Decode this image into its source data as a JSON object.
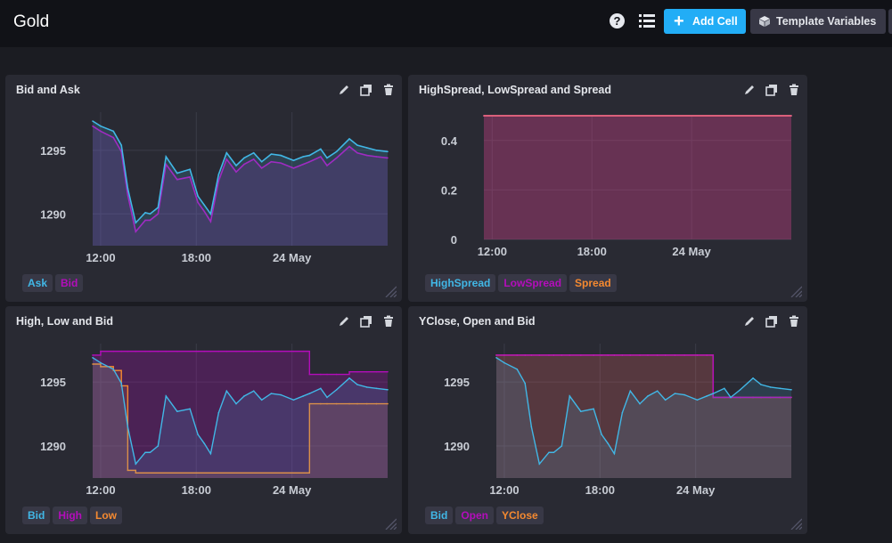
{
  "header": {
    "title": "Gold",
    "add_cell_label": "Add Cell",
    "template_variables_label": "Template Variables",
    "help_glyph": "?"
  },
  "colors": {
    "background": "#1b1c22",
    "cell": "#292a33",
    "accent": "#22adf6",
    "ask": "#41b7e6",
    "bid_purple": "#b40dbb",
    "bid_blue": "#4cc0f0",
    "orange": "#f48930",
    "salmon": "#f66c6f"
  },
  "icons": [
    "help-icon",
    "list-icon",
    "plus-icon",
    "cube-icon",
    "pencil-icon",
    "duplicate-icon",
    "trash-icon",
    "resize-handle-icon"
  ],
  "cells": [
    {
      "title": "Bid and Ask",
      "legend": [
        {
          "label": "Ask",
          "color": "#41b7e6"
        },
        {
          "label": "Bid",
          "color": "#b40dbb"
        }
      ]
    },
    {
      "title": "HighSpread, LowSpread and Spread",
      "legend": [
        {
          "label": "HighSpread",
          "color": "#41b7e6"
        },
        {
          "label": "LowSpread",
          "color": "#b40dbb"
        },
        {
          "label": "Spread",
          "color": "#f48930"
        }
      ]
    },
    {
      "title": "High, Low and Bid",
      "legend": [
        {
          "label": "Bid",
          "color": "#41b7e6"
        },
        {
          "label": "High",
          "color": "#b40dbb"
        },
        {
          "label": "Low",
          "color": "#f48930"
        }
      ]
    },
    {
      "title": "YClose, Open and Bid",
      "legend": [
        {
          "label": "Bid",
          "color": "#41b7e6"
        },
        {
          "label": "Open",
          "color": "#b40dbb"
        },
        {
          "label": "YClose",
          "color": "#f48930"
        }
      ]
    }
  ],
  "chart_data": [
    {
      "type": "line",
      "title": "Bid and Ask",
      "x_ticks": [
        "12:00",
        "18:00",
        "24 May"
      ],
      "y_ticks": [
        1295,
        1290
      ],
      "ylim": [
        1287.5,
        1298
      ],
      "grid": true,
      "x": [
        0,
        0.5,
        1.3,
        1.8,
        2.2,
        2.7,
        3.3,
        3.6,
        4.1,
        4.6,
        5.3,
        6.1,
        6.6,
        7.0,
        7.4,
        7.9,
        8.4,
        9.0,
        9.5,
        10.1,
        10.6,
        11.2,
        11.8,
        12.6,
        13.2,
        13.6,
        14.3,
        14.7,
        15.3,
        16.1,
        16.6,
        17.2,
        17.8,
        18.5
      ],
      "series": [
        {
          "name": "Ask",
          "values": [
            1297.3,
            1296.9,
            1296.5,
            1295.4,
            1292.0,
            1289.3,
            1290.1,
            1290.0,
            1290.5,
            1294.5,
            1293.2,
            1293.5,
            1291.4,
            1290.7,
            1290.0,
            1293.1,
            1294.8,
            1293.8,
            1294.4,
            1294.8,
            1294.1,
            1294.7,
            1294.6,
            1294.2,
            1294.5,
            1294.6,
            1295.1,
            1294.4,
            1294.9,
            1295.9,
            1295.4,
            1295.2,
            1295.0,
            1294.9
          ]
        },
        {
          "name": "Bid",
          "values": [
            1296.9,
            1296.5,
            1296.0,
            1294.9,
            1291.5,
            1288.6,
            1289.5,
            1289.5,
            1290.0,
            1293.9,
            1292.7,
            1292.9,
            1290.9,
            1290.2,
            1289.4,
            1292.6,
            1294.3,
            1293.3,
            1293.9,
            1294.3,
            1293.6,
            1294.1,
            1294.0,
            1293.6,
            1293.9,
            1294.1,
            1294.5,
            1293.8,
            1294.4,
            1295.3,
            1294.8,
            1294.6,
            1294.5,
            1294.4
          ]
        }
      ]
    },
    {
      "type": "area",
      "title": "HighSpread, LowSpread and Spread",
      "x_ticks": [
        "12:00",
        "18:00",
        "24 May"
      ],
      "y_ticks": [
        0.4,
        0.2,
        0
      ],
      "ylim": [
        0,
        0.5
      ],
      "grid": true,
      "x": [
        0,
        18.5
      ],
      "series": [
        {
          "name": "HighSpread",
          "values": [
            0.5,
            0.5
          ]
        },
        {
          "name": "LowSpread",
          "values": [
            0.5,
            0.5
          ]
        },
        {
          "name": "Spread",
          "values": [
            0.5,
            0.5
          ]
        }
      ]
    },
    {
      "type": "line",
      "title": "High, Low and Bid",
      "x_ticks": [
        "12:00",
        "18:00",
        "24 May"
      ],
      "y_ticks": [
        1295,
        1290
      ],
      "ylim": [
        1287.5,
        1298
      ],
      "grid": true,
      "x": [
        0,
        0.5,
        1.3,
        1.8,
        2.2,
        2.7,
        3.3,
        3.6,
        4.1,
        4.6,
        5.3,
        6.1,
        6.6,
        7.0,
        7.4,
        7.9,
        8.4,
        9.0,
        9.5,
        10.1,
        10.6,
        11.2,
        11.8,
        12.6,
        13.2,
        13.6,
        14.3,
        14.7,
        15.3,
        16.1,
        16.6,
        17.2,
        17.8,
        18.5
      ],
      "series": [
        {
          "name": "Bid",
          "values": [
            1296.9,
            1296.5,
            1296.0,
            1294.9,
            1291.5,
            1288.6,
            1289.5,
            1289.5,
            1290.0,
            1293.9,
            1292.7,
            1292.9,
            1290.9,
            1290.2,
            1289.4,
            1292.6,
            1294.3,
            1293.3,
            1293.9,
            1294.3,
            1293.6,
            1294.1,
            1294.0,
            1293.6,
            1293.9,
            1294.1,
            1294.5,
            1293.8,
            1294.4,
            1295.3,
            1294.8,
            1294.6,
            1294.5,
            1294.4
          ]
        },
        {
          "name": "High",
          "values": [
            1297.1,
            1297.4,
            1297.4,
            1297.4,
            1297.4,
            1297.4,
            1297.4,
            1297.4,
            1297.4,
            1297.4,
            1297.4,
            1297.4,
            1297.4,
            1297.4,
            1297.4,
            1297.4,
            1297.4,
            1297.4,
            1297.4,
            1297.4,
            1297.4,
            1297.4,
            1297.4,
            1297.4,
            1297.4,
            1295.6,
            1295.6,
            1295.6,
            1295.6,
            1295.8,
            1295.8,
            1295.8,
            1295.8,
            1295.8
          ]
        },
        {
          "name": "Low",
          "values": [
            1296.4,
            1296.2,
            1295.9,
            1294.7,
            1288.1,
            1287.9,
            1287.9,
            1287.9,
            1287.9,
            1287.9,
            1287.9,
            1287.9,
            1287.9,
            1287.9,
            1287.9,
            1287.9,
            1287.9,
            1287.9,
            1287.9,
            1287.9,
            1287.9,
            1287.9,
            1287.9,
            1287.9,
            1287.9,
            1293.3,
            1293.3,
            1293.3,
            1293.3,
            1293.3,
            1293.3,
            1293.3,
            1293.3,
            1293.3
          ]
        }
      ]
    },
    {
      "type": "line",
      "title": "YClose, Open and Bid",
      "x_ticks": [
        "12:00",
        "18:00",
        "24 May"
      ],
      "y_ticks": [
        1295,
        1290
      ],
      "ylim": [
        1287.5,
        1298
      ],
      "grid": true,
      "x": [
        0,
        0.5,
        1.3,
        1.8,
        2.2,
        2.7,
        3.3,
        3.6,
        4.1,
        4.6,
        5.3,
        6.1,
        6.6,
        7.0,
        7.4,
        7.9,
        8.4,
        9.0,
        9.5,
        10.1,
        10.6,
        11.2,
        11.8,
        12.6,
        13.2,
        13.6,
        14.3,
        14.7,
        15.3,
        16.1,
        16.6,
        17.2,
        17.8,
        18.5
      ],
      "series": [
        {
          "name": "Bid",
          "values": [
            1296.9,
            1296.5,
            1296.0,
            1294.9,
            1291.5,
            1288.6,
            1289.5,
            1289.5,
            1290.0,
            1293.9,
            1292.7,
            1292.9,
            1290.9,
            1290.2,
            1289.4,
            1292.6,
            1294.3,
            1293.3,
            1293.9,
            1294.3,
            1293.6,
            1294.1,
            1294.0,
            1293.6,
            1293.9,
            1294.1,
            1294.5,
            1293.8,
            1294.4,
            1295.3,
            1294.8,
            1294.6,
            1294.5,
            1294.4
          ]
        },
        {
          "name": "Open",
          "values": [
            1297.1,
            1297.1,
            1297.1,
            1297.1,
            1297.1,
            1297.1,
            1297.1,
            1297.1,
            1297.1,
            1297.1,
            1297.1,
            1297.1,
            1297.1,
            1297.1,
            1297.1,
            1297.1,
            1297.1,
            1297.1,
            1297.1,
            1297.1,
            1297.1,
            1297.1,
            1297.1,
            1297.1,
            1297.1,
            1293.8,
            1293.8,
            1293.8,
            1293.8,
            1293.8,
            1293.8,
            1293.8,
            1293.8,
            1293.8
          ]
        },
        {
          "name": "YClose",
          "values": [
            1297.1,
            1297.1,
            1297.1,
            1297.1,
            1297.1,
            1297.1,
            1297.1,
            1297.1,
            1297.1,
            1297.1,
            1297.1,
            1297.1,
            1297.1,
            1297.1,
            1297.1,
            1297.1,
            1297.1,
            1297.1,
            1297.1,
            1297.1,
            1297.1,
            1297.1,
            1297.1,
            1297.1,
            1297.1,
            1293.8,
            1293.8,
            1293.8,
            1293.8,
            1293.8,
            1293.8,
            1293.8,
            1293.8,
            1293.8
          ]
        }
      ]
    }
  ]
}
